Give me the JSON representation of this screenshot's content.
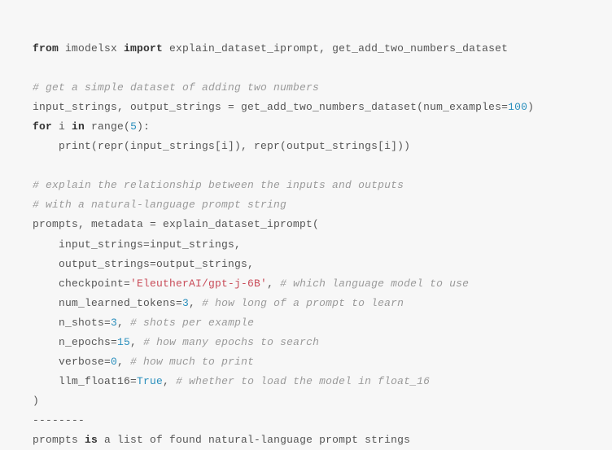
{
  "code": {
    "l1_from": "from",
    "l1_mod": " imodelsx ",
    "l1_import": "import",
    "l1_rest": " explain_dataset_iprompt, get_add_two_numbers_dataset",
    "l2_comment": "# get a simple dataset of adding two numbers",
    "l3_pre": "input_strings, output_strings = get_add_two_numbers_dataset(num_examples=",
    "l3_num": "100",
    "l3_post": ")",
    "l4_for": "for",
    "l4_mid": " i ",
    "l4_in": "in",
    "l4_range": " range(",
    "l4_num": "5",
    "l4_close": "):",
    "l5_indent": "    print(repr(input_strings[i]), repr(output_strings[i]))",
    "l6_comment": "# explain the relationship between the inputs and outputs",
    "l7_comment": "# with a natural-language prompt string",
    "l8": "prompts, metadata = explain_dataset_iprompt(",
    "l9": "    input_strings=input_strings,",
    "l10": "    output_strings=output_strings,",
    "l11_pre": "    checkpoint=",
    "l11_str": "'EleutherAI/gpt-j-6B'",
    "l11_post": ", ",
    "l11_comment": "# which language model to use",
    "l12_pre": "    num_learned_tokens=",
    "l12_num": "3",
    "l12_post": ", ",
    "l12_comment": "# how long of a prompt to learn",
    "l13_pre": "    n_shots=",
    "l13_num": "3",
    "l13_post": ", ",
    "l13_comment": "# shots per example",
    "l14_pre": "    n_epochs=",
    "l14_num": "15",
    "l14_post": ", ",
    "l14_comment": "# how many epochs to search",
    "l15_pre": "    verbose=",
    "l15_num": "0",
    "l15_post": ", ",
    "l15_comment": "# how much to print",
    "l16_pre": "    llm_float16=",
    "l16_bool": "True",
    "l16_post": ", ",
    "l16_comment": "# whether to load the model in float_16",
    "l17": ")",
    "l18": "--------",
    "l19_pre": "prompts ",
    "l19_is": "is",
    "l19_post": " a list of found natural-language prompt strings"
  }
}
